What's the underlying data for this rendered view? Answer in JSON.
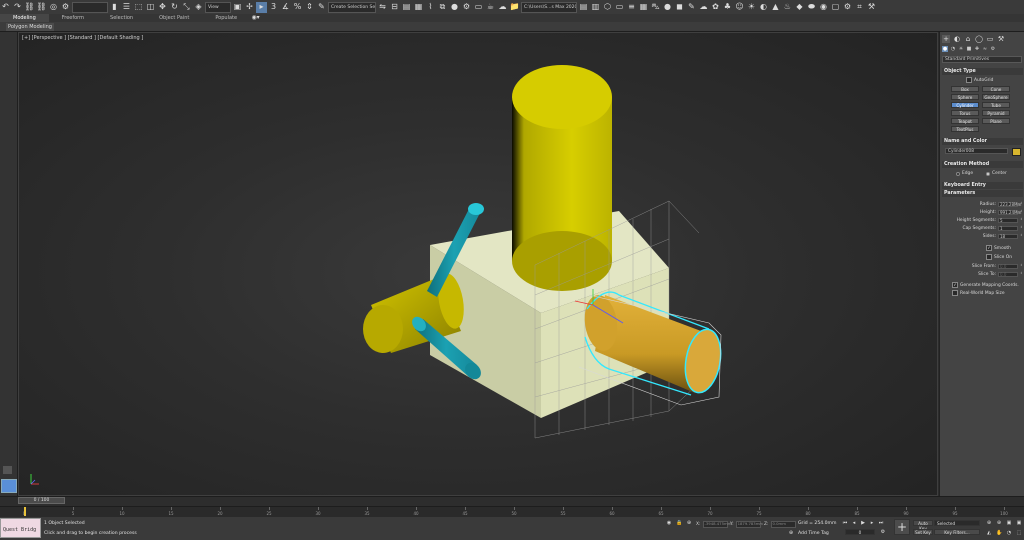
{
  "toolbar": {
    "selection_set_placeholder": "",
    "view_dropdown": "View",
    "create_selection_set": "Create Selection Se",
    "path_field": "C:\\Users\\S...s Max 2020",
    "snap_value": "3"
  },
  "ribbon": {
    "tabs": [
      {
        "label": "Modeling",
        "active": true
      },
      {
        "label": "Freeform",
        "active": false
      },
      {
        "label": "Selection",
        "active": false
      },
      {
        "label": "Object Paint",
        "active": false
      },
      {
        "label": "Populate",
        "active": false
      }
    ],
    "panel_label": "Polygon Modeling"
  },
  "viewport": {
    "label": "[+] [Perspective ] [Standard ] [Default Shading ]",
    "colors": {
      "cylinder_yellow": "#d5cc00",
      "box_light": "#dde1b8",
      "arms_cyan": "#1ba1b2",
      "orange_cylinder": "#d1a12c",
      "selection_outline": "#33e8ff"
    }
  },
  "command_panel": {
    "dropdown": "Standard Primitives",
    "object_type": {
      "title": "Object Type",
      "autogrid": "AutoGrid",
      "buttons": [
        {
          "label": "Box",
          "active": false
        },
        {
          "label": "Cone",
          "active": false
        },
        {
          "label": "Sphere",
          "active": false
        },
        {
          "label": "GeoSphere",
          "active": false
        },
        {
          "label": "Cylinder",
          "active": true
        },
        {
          "label": "Tube",
          "active": false
        },
        {
          "label": "Torus",
          "active": false
        },
        {
          "label": "Pyramid",
          "active": false
        },
        {
          "label": "Teapot",
          "active": false
        },
        {
          "label": "Plane",
          "active": false
        },
        {
          "label": "TextPlus",
          "active": false
        }
      ]
    },
    "name_and_color": {
      "title": "Name and Color",
      "name": "Cylinder008",
      "color": "#d7b52e"
    },
    "creation_method": {
      "title": "Creation Method",
      "options": [
        "Edge",
        "Center"
      ],
      "selected": "Center"
    },
    "keyboard_entry": {
      "title": "Keyboard Entry"
    },
    "parameters": {
      "title": "Parameters",
      "rows": [
        {
          "label": "Radius:",
          "value": "223.28Mm"
        },
        {
          "label": "Height:",
          "value": "991.24Mm"
        },
        {
          "label": "Height Segments:",
          "value": "5"
        },
        {
          "label": "Cap Segments:",
          "value": "1"
        },
        {
          "label": "Sides:",
          "value": "18"
        }
      ],
      "smooth": "Smooth",
      "slice_on": "Slice On",
      "slice_from": "Slice From:",
      "slice_to": "Slice To:",
      "slice_from_value": "0.0",
      "slice_to_value": "0.0",
      "gen_mapping": "Generate Mapping Coords.",
      "real_world": "Real-World Map Size"
    }
  },
  "time": {
    "slider_label": "0 / 100",
    "ticks": [
      "0",
      "5",
      "10",
      "15",
      "20",
      "25",
      "30",
      "35",
      "40",
      "45",
      "50",
      "55",
      "60",
      "65",
      "70",
      "75",
      "80",
      "85",
      "90",
      "95",
      "100"
    ]
  },
  "status": {
    "maxscript": "Quest Bridg",
    "objects_selected": "1 Object Selected",
    "prompt": "Click and drag to begin creation process",
    "x_label": "X:",
    "y_label": "Y:",
    "z_label": "Z:",
    "x_value": "-3948.475mm",
    "y_value": "1879.783mm",
    "z_value": "0.0mm",
    "grid": "Grid = 254.0mm",
    "add_time_tag": "Add Time Tag",
    "auto_key": "Auto Key",
    "set_key": "Set Key",
    "selected": "Selected",
    "key_filters": "Key Filters...",
    "frame": "0"
  }
}
